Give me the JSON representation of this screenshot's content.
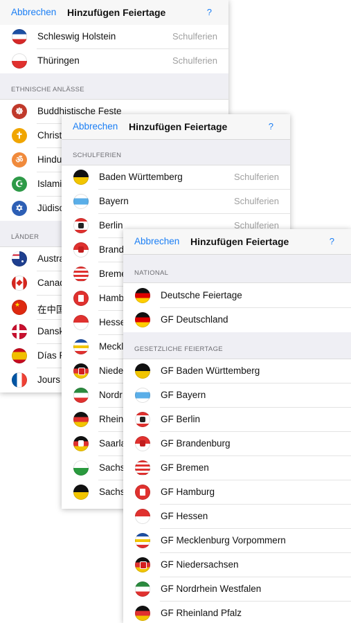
{
  "panel1": {
    "nav": {
      "left": "Abbrechen",
      "title": "Hinzufügen Feiertage",
      "right": "?"
    },
    "top_rows": [
      {
        "label": "Schleswig Holstein",
        "detail": "Schulferien"
      },
      {
        "label": "Thüringen",
        "detail": "Schulferien"
      }
    ],
    "ethnic_header": "ETHNISCHE ANLÄSSE",
    "ethnic_rows": [
      {
        "label": "Buddhistische Feste"
      },
      {
        "label": "Christ"
      },
      {
        "label": "Hindu"
      },
      {
        "label": "Islami"
      },
      {
        "label": "Jüdisc"
      }
    ],
    "countries_header": "LÄNDER",
    "country_rows": [
      {
        "label": "Austra"
      },
      {
        "label": "Canad"
      },
      {
        "label": "在中国"
      },
      {
        "label": "Dansk"
      },
      {
        "label": "Días F"
      },
      {
        "label": "Jours"
      }
    ]
  },
  "panel2": {
    "nav": {
      "left": "Abbrechen",
      "title": "Hinzufügen Feiertage",
      "right": "?"
    },
    "header": "SCHULFERIEN",
    "rows": [
      {
        "label": "Baden Württemberg",
        "detail": "Schulferien"
      },
      {
        "label": "Bayern",
        "detail": "Schulferien"
      },
      {
        "label": "Berlin",
        "detail": "Schulferien"
      },
      {
        "label": "Brand",
        "detail": ""
      },
      {
        "label": "Breme",
        "detail": ""
      },
      {
        "label": "Hamb",
        "detail": ""
      },
      {
        "label": "Hesse",
        "detail": ""
      },
      {
        "label": "Meckl",
        "detail": ""
      },
      {
        "label": "Niede",
        "detail": ""
      },
      {
        "label": "Nordr",
        "detail": ""
      },
      {
        "label": "Rhein",
        "detail": ""
      },
      {
        "label": "Saarla",
        "detail": ""
      },
      {
        "label": "Sachs",
        "detail": ""
      },
      {
        "label": "Sachs",
        "detail": ""
      }
    ]
  },
  "panel3": {
    "nav": {
      "left": "Abbrechen",
      "title": "Hinzufügen Feiertage",
      "right": "?"
    },
    "national_header": "NATIONAL",
    "national_rows": [
      {
        "label": "Deutsche Feiertage"
      },
      {
        "label": "GF Deutschland"
      }
    ],
    "legal_header": "GESETZLICHE FEIERTAGE",
    "legal_rows": [
      {
        "label": "GF Baden Württemberg"
      },
      {
        "label": "GF Bayern"
      },
      {
        "label": "GF Berlin"
      },
      {
        "label": "GF Brandenburg"
      },
      {
        "label": "GF Bremen"
      },
      {
        "label": "GF Hamburg"
      },
      {
        "label": "GF Hessen"
      },
      {
        "label": "GF Mecklenburg Vorpommern"
      },
      {
        "label": "GF Niedersachsen"
      },
      {
        "label": "GF Nordrhein Westfalen"
      },
      {
        "label": "GF Rheinland Pfalz"
      }
    ]
  },
  "icons": {
    "schleswig-holstein-flag-icon": "blue-white-red",
    "thueringen-flag-icon": "white-red",
    "buddhist-wheel-icon": "#c0392b",
    "christian-cross-icon": "#f0a500",
    "hindu-om-icon": "#f08a3c",
    "islam-crescent-icon": "#2e9a48",
    "jewish-star-icon": "#2d5fb5",
    "australia-flag-icon": "#1f3f8f",
    "canada-flag-icon": "#d7261e",
    "china-flag-icon": "#de2910",
    "denmark-flag-icon": "#c8102e",
    "spain-flag-icon": "#f1bf00",
    "france-flag-icon": "#0055a4",
    "germany-flag-icon": "black-red-gold"
  },
  "colors": {
    "accent": "#1a7ef5",
    "detail": "#a0a0a0",
    "section_bg": "#efeff4"
  }
}
